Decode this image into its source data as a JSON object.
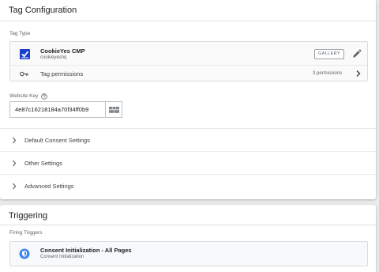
{
  "tag_config": {
    "title": "Tag Configuration",
    "tag_type_label": "Tag Type",
    "tag": {
      "name": "CookieYes CMP",
      "vendor": "cookieyeshq",
      "gallery_label": "GALLERY",
      "logo_color": "#1a3fcf"
    },
    "permissions": {
      "label": "Tag permissions",
      "count": "3 permissions"
    },
    "website_key": {
      "label": "Website Key",
      "value": "4e87c16218184a70f34ff0b9"
    },
    "sections": [
      {
        "label": "Default Consent Settings"
      },
      {
        "label": "Other Settings"
      },
      {
        "label": "Advanced Settings"
      }
    ]
  },
  "triggering": {
    "title": "Triggering",
    "firing_label": "Firing Triggers",
    "trigger": {
      "name": "Consent Initialization - All Pages",
      "type": "Consent Initialization",
      "icon_color": "#4285f4"
    }
  }
}
